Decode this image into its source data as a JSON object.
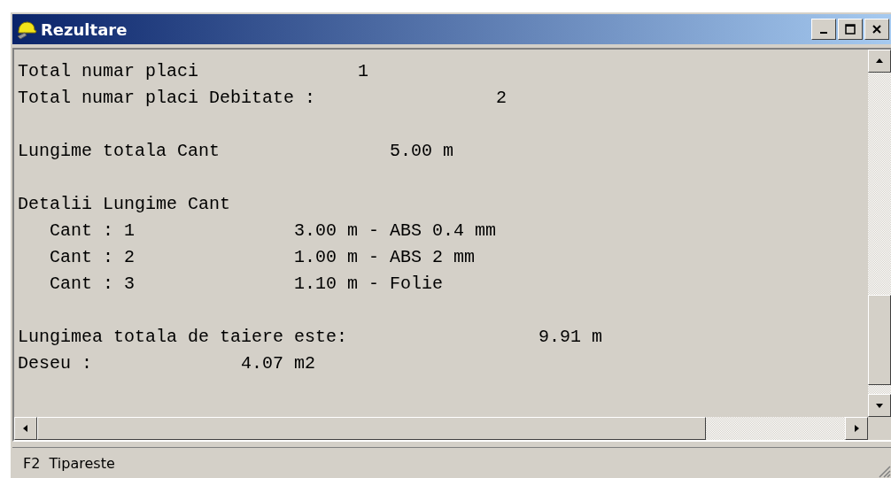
{
  "window": {
    "title": "Rezultare"
  },
  "report": {
    "sections": [
      [
        "Total numar placi               1",
        "Total numar placi Debitate :                 2"
      ],
      [
        "Lungime totala Cant                5.00 m"
      ],
      [
        "Detalii Lungime Cant",
        "   Cant : 1               3.00 m - ABS 0.4 mm",
        "   Cant : 2               1.00 m - ABS 2 mm",
        "   Cant : 3               1.10 m - Folie"
      ],
      [
        "Lungimea totala de taiere este:                  9.91 m",
        "Deseu :              4.07 m2"
      ]
    ]
  },
  "status_bar": {
    "text": "F2  Tipareste"
  }
}
